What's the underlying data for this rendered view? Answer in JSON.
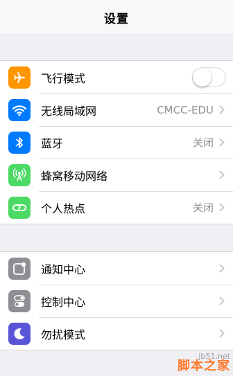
{
  "navbar": {
    "title": "设置"
  },
  "group1": [
    {
      "label": "飞行模式",
      "icon": "airplane-icon",
      "color": "#ff9500",
      "toggle": false
    },
    {
      "label": "无线局域网",
      "icon": "wifi-icon",
      "color": "#007aff",
      "value": "CMCC-EDU"
    },
    {
      "label": "蓝牙",
      "icon": "bluetooth-icon",
      "color": "#007aff",
      "value": "关闭"
    },
    {
      "label": "蜂窝移动网络",
      "icon": "cellular-antenna-icon",
      "color": "#4cd964"
    },
    {
      "label": "个人热点",
      "icon": "hotspot-icon",
      "color": "#4cd964",
      "value": "关闭"
    }
  ],
  "group2": [
    {
      "label": "通知中心",
      "icon": "notification-center-icon",
      "color": "#8e8e93"
    },
    {
      "label": "控制中心",
      "icon": "control-center-icon",
      "color": "#8e8e93"
    },
    {
      "label": "勿扰模式",
      "icon": "moon-icon",
      "color": "#5856d6"
    }
  ],
  "watermark": {
    "url": "jb51.net",
    "brand": "脚本之家"
  }
}
